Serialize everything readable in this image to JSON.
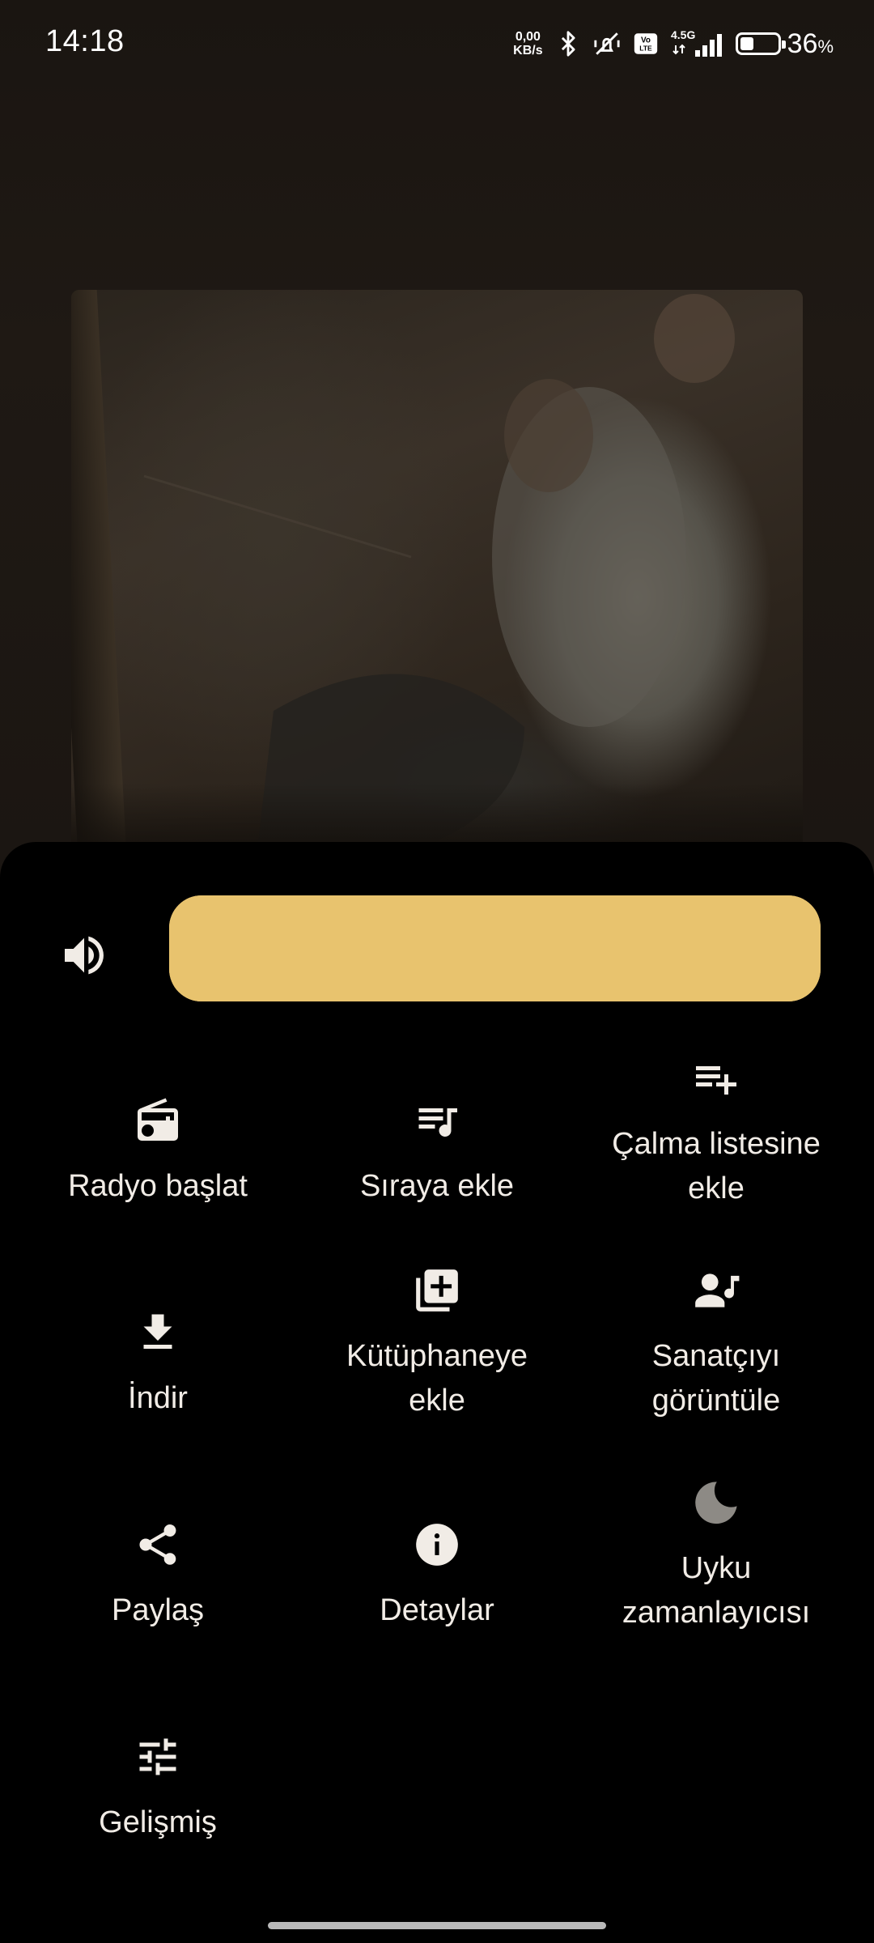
{
  "status_bar": {
    "time": "14:18",
    "net_speed_value": "0,00",
    "net_speed_unit": "KB/s",
    "volte": "Vo LTE",
    "network": "4.5G",
    "battery_percent": "36",
    "battery_unit": "%",
    "battery_level": 0.36
  },
  "player": {
    "album_art": "album-art-photo",
    "volume_icon": "volume-up-icon",
    "volume_level": 1.0,
    "accent_color": "#e8c36e"
  },
  "actions": [
    {
      "label": "Radyo başlat",
      "icon": "radio-icon"
    },
    {
      "label": "Sıraya ekle",
      "icon": "queue-music-icon"
    },
    {
      "label": "Çalma listesine\nekle",
      "icon": "playlist-add-icon"
    },
    {
      "label": "İndir",
      "icon": "download-icon"
    },
    {
      "label": "Kütüphaneye\nekle",
      "icon": "library-add-icon"
    },
    {
      "label": "Sanatçıyı\ngörüntüle",
      "icon": "artist-icon"
    },
    {
      "label": "Paylaş",
      "icon": "share-icon"
    },
    {
      "label": "Detaylar",
      "icon": "info-icon"
    },
    {
      "label": "Uyku\nzamanlayıcısı",
      "icon": "sleep-timer-moon-icon"
    },
    {
      "label": "Gelişmiş",
      "icon": "tune-sliders-icon"
    }
  ]
}
